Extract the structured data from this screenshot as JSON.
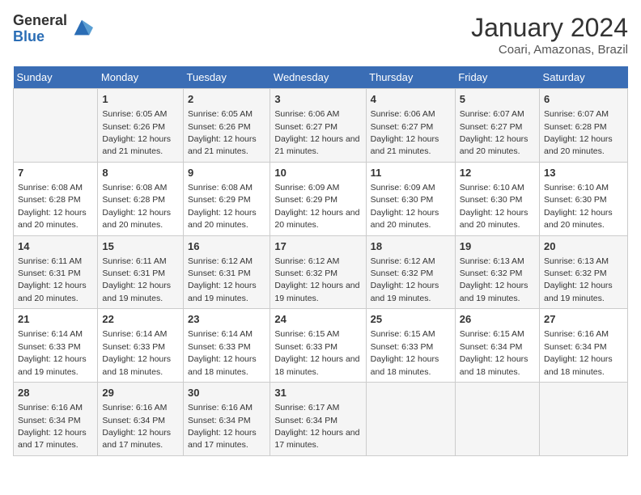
{
  "logo": {
    "general": "General",
    "blue": "Blue"
  },
  "title": "January 2024",
  "subtitle": "Coari, Amazonas, Brazil",
  "days_of_week": [
    "Sunday",
    "Monday",
    "Tuesday",
    "Wednesday",
    "Thursday",
    "Friday",
    "Saturday"
  ],
  "weeks": [
    [
      {
        "day": "",
        "sunrise": "",
        "sunset": "",
        "daylight": ""
      },
      {
        "day": "1",
        "sunrise": "Sunrise: 6:05 AM",
        "sunset": "Sunset: 6:26 PM",
        "daylight": "Daylight: 12 hours and 21 minutes."
      },
      {
        "day": "2",
        "sunrise": "Sunrise: 6:05 AM",
        "sunset": "Sunset: 6:26 PM",
        "daylight": "Daylight: 12 hours and 21 minutes."
      },
      {
        "day": "3",
        "sunrise": "Sunrise: 6:06 AM",
        "sunset": "Sunset: 6:27 PM",
        "daylight": "Daylight: 12 hours and 21 minutes."
      },
      {
        "day": "4",
        "sunrise": "Sunrise: 6:06 AM",
        "sunset": "Sunset: 6:27 PM",
        "daylight": "Daylight: 12 hours and 21 minutes."
      },
      {
        "day": "5",
        "sunrise": "Sunrise: 6:07 AM",
        "sunset": "Sunset: 6:27 PM",
        "daylight": "Daylight: 12 hours and 20 minutes."
      },
      {
        "day": "6",
        "sunrise": "Sunrise: 6:07 AM",
        "sunset": "Sunset: 6:28 PM",
        "daylight": "Daylight: 12 hours and 20 minutes."
      }
    ],
    [
      {
        "day": "7",
        "sunrise": "Sunrise: 6:08 AM",
        "sunset": "Sunset: 6:28 PM",
        "daylight": "Daylight: 12 hours and 20 minutes."
      },
      {
        "day": "8",
        "sunrise": "Sunrise: 6:08 AM",
        "sunset": "Sunset: 6:28 PM",
        "daylight": "Daylight: 12 hours and 20 minutes."
      },
      {
        "day": "9",
        "sunrise": "Sunrise: 6:08 AM",
        "sunset": "Sunset: 6:29 PM",
        "daylight": "Daylight: 12 hours and 20 minutes."
      },
      {
        "day": "10",
        "sunrise": "Sunrise: 6:09 AM",
        "sunset": "Sunset: 6:29 PM",
        "daylight": "Daylight: 12 hours and 20 minutes."
      },
      {
        "day": "11",
        "sunrise": "Sunrise: 6:09 AM",
        "sunset": "Sunset: 6:30 PM",
        "daylight": "Daylight: 12 hours and 20 minutes."
      },
      {
        "day": "12",
        "sunrise": "Sunrise: 6:10 AM",
        "sunset": "Sunset: 6:30 PM",
        "daylight": "Daylight: 12 hours and 20 minutes."
      },
      {
        "day": "13",
        "sunrise": "Sunrise: 6:10 AM",
        "sunset": "Sunset: 6:30 PM",
        "daylight": "Daylight: 12 hours and 20 minutes."
      }
    ],
    [
      {
        "day": "14",
        "sunrise": "Sunrise: 6:11 AM",
        "sunset": "Sunset: 6:31 PM",
        "daylight": "Daylight: 12 hours and 20 minutes."
      },
      {
        "day": "15",
        "sunrise": "Sunrise: 6:11 AM",
        "sunset": "Sunset: 6:31 PM",
        "daylight": "Daylight: 12 hours and 19 minutes."
      },
      {
        "day": "16",
        "sunrise": "Sunrise: 6:12 AM",
        "sunset": "Sunset: 6:31 PM",
        "daylight": "Daylight: 12 hours and 19 minutes."
      },
      {
        "day": "17",
        "sunrise": "Sunrise: 6:12 AM",
        "sunset": "Sunset: 6:32 PM",
        "daylight": "Daylight: 12 hours and 19 minutes."
      },
      {
        "day": "18",
        "sunrise": "Sunrise: 6:12 AM",
        "sunset": "Sunset: 6:32 PM",
        "daylight": "Daylight: 12 hours and 19 minutes."
      },
      {
        "day": "19",
        "sunrise": "Sunrise: 6:13 AM",
        "sunset": "Sunset: 6:32 PM",
        "daylight": "Daylight: 12 hours and 19 minutes."
      },
      {
        "day": "20",
        "sunrise": "Sunrise: 6:13 AM",
        "sunset": "Sunset: 6:32 PM",
        "daylight": "Daylight: 12 hours and 19 minutes."
      }
    ],
    [
      {
        "day": "21",
        "sunrise": "Sunrise: 6:14 AM",
        "sunset": "Sunset: 6:33 PM",
        "daylight": "Daylight: 12 hours and 19 minutes."
      },
      {
        "day": "22",
        "sunrise": "Sunrise: 6:14 AM",
        "sunset": "Sunset: 6:33 PM",
        "daylight": "Daylight: 12 hours and 18 minutes."
      },
      {
        "day": "23",
        "sunrise": "Sunrise: 6:14 AM",
        "sunset": "Sunset: 6:33 PM",
        "daylight": "Daylight: 12 hours and 18 minutes."
      },
      {
        "day": "24",
        "sunrise": "Sunrise: 6:15 AM",
        "sunset": "Sunset: 6:33 PM",
        "daylight": "Daylight: 12 hours and 18 minutes."
      },
      {
        "day": "25",
        "sunrise": "Sunrise: 6:15 AM",
        "sunset": "Sunset: 6:33 PM",
        "daylight": "Daylight: 12 hours and 18 minutes."
      },
      {
        "day": "26",
        "sunrise": "Sunrise: 6:15 AM",
        "sunset": "Sunset: 6:34 PM",
        "daylight": "Daylight: 12 hours and 18 minutes."
      },
      {
        "day": "27",
        "sunrise": "Sunrise: 6:16 AM",
        "sunset": "Sunset: 6:34 PM",
        "daylight": "Daylight: 12 hours and 18 minutes."
      }
    ],
    [
      {
        "day": "28",
        "sunrise": "Sunrise: 6:16 AM",
        "sunset": "Sunset: 6:34 PM",
        "daylight": "Daylight: 12 hours and 17 minutes."
      },
      {
        "day": "29",
        "sunrise": "Sunrise: 6:16 AM",
        "sunset": "Sunset: 6:34 PM",
        "daylight": "Daylight: 12 hours and 17 minutes."
      },
      {
        "day": "30",
        "sunrise": "Sunrise: 6:16 AM",
        "sunset": "Sunset: 6:34 PM",
        "daylight": "Daylight: 12 hours and 17 minutes."
      },
      {
        "day": "31",
        "sunrise": "Sunrise: 6:17 AM",
        "sunset": "Sunset: 6:34 PM",
        "daylight": "Daylight: 12 hours and 17 minutes."
      },
      {
        "day": "",
        "sunrise": "",
        "sunset": "",
        "daylight": ""
      },
      {
        "day": "",
        "sunrise": "",
        "sunset": "",
        "daylight": ""
      },
      {
        "day": "",
        "sunrise": "",
        "sunset": "",
        "daylight": ""
      }
    ]
  ]
}
